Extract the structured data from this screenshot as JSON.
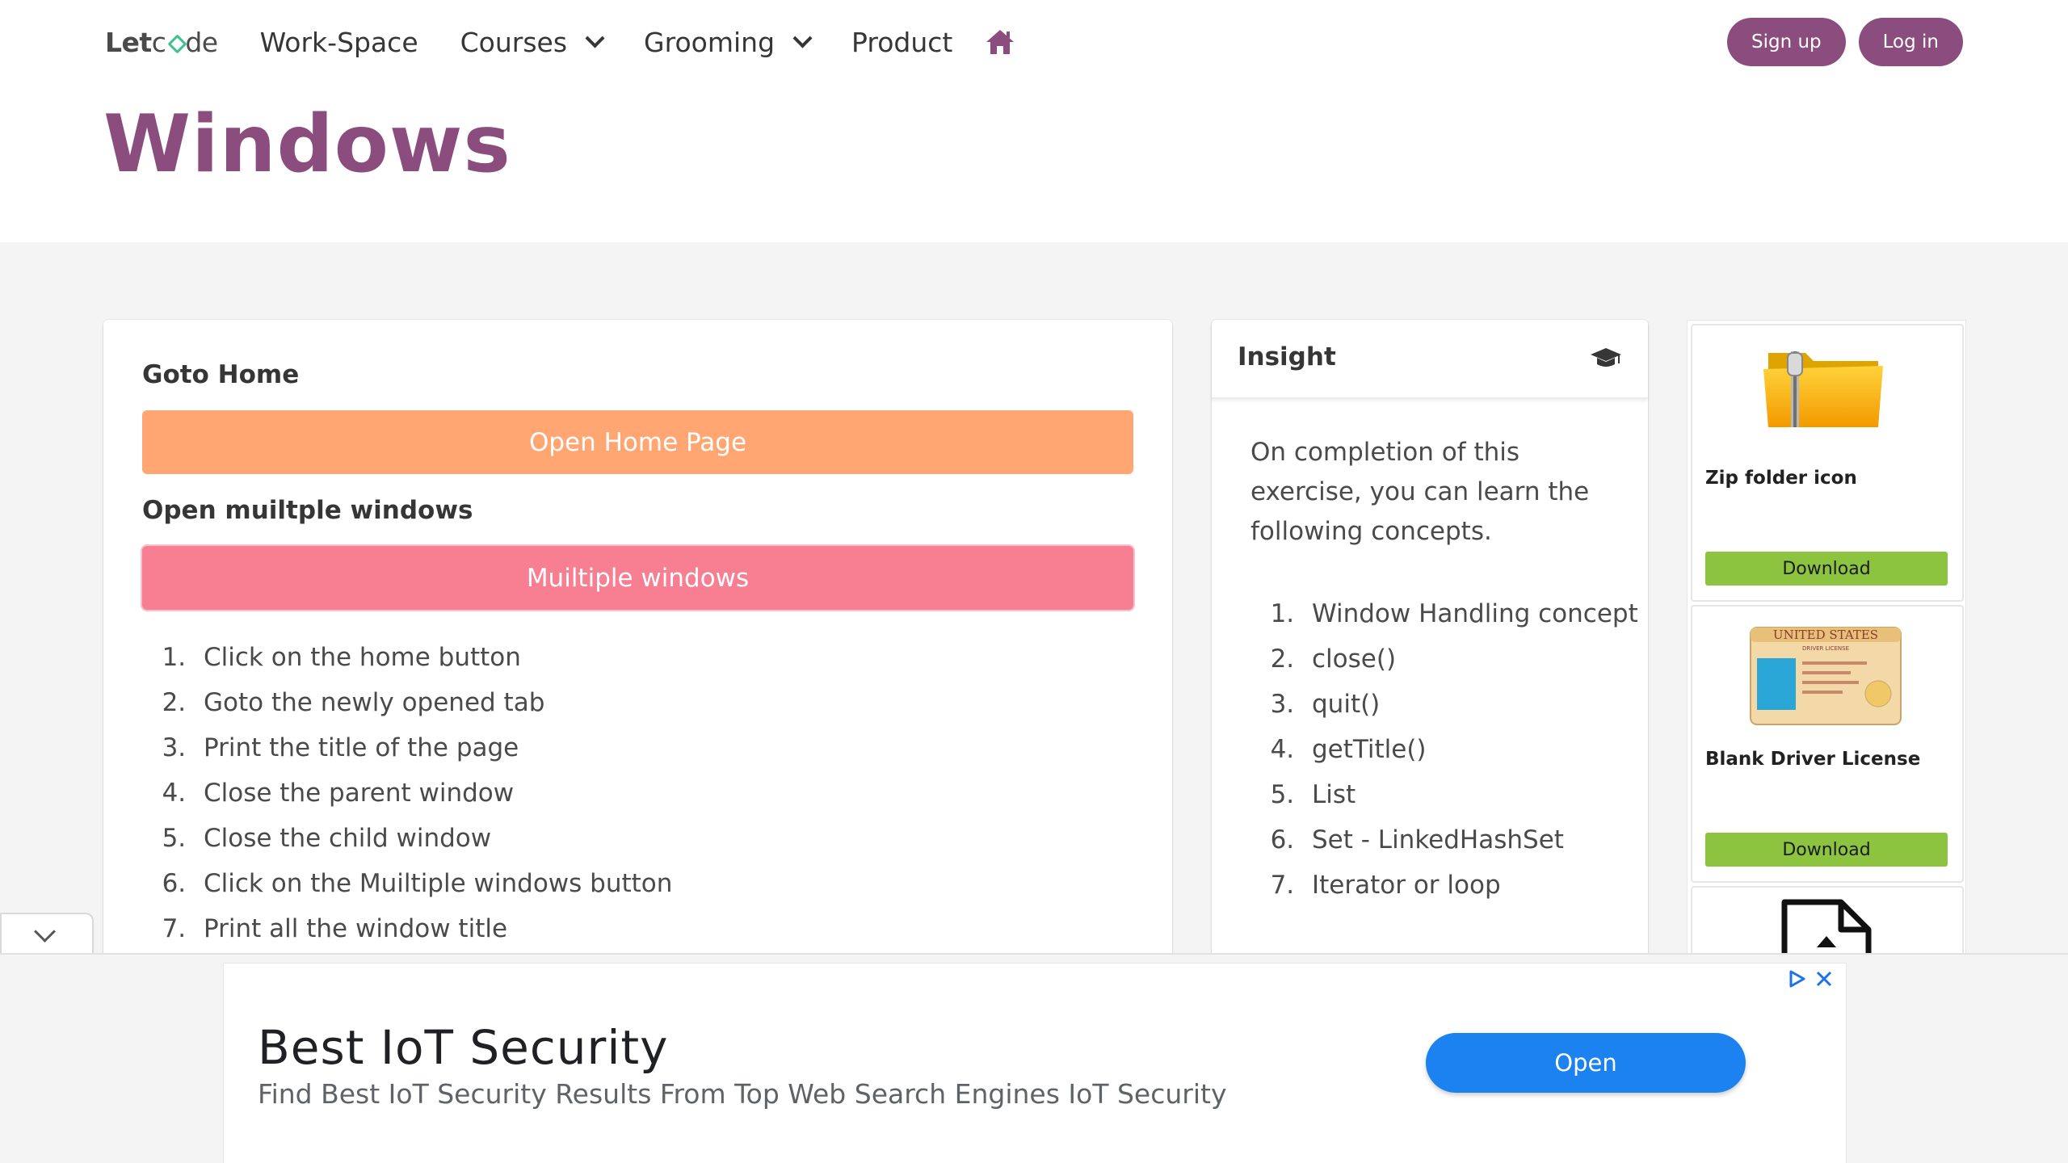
{
  "nav": {
    "logo_bold": "Let",
    "logo_light": "de",
    "items": [
      {
        "label": "Work-Space"
      },
      {
        "label": "Courses"
      },
      {
        "label": "Grooming"
      },
      {
        "label": "Product"
      }
    ],
    "signup": "Sign up",
    "login": "Log in"
  },
  "page": {
    "title": "Windows"
  },
  "main": {
    "goto_home_label": "Goto Home",
    "open_home_button": "Open Home Page",
    "multiple_label": "Open muiltple windows",
    "multiple_button": "Muiltiple windows",
    "steps": [
      "Click on the home button",
      "Goto the newly opened tab",
      "Print the title of the page",
      "Close the parent window",
      "Close the child window",
      "Click on the Muiltiple windows button",
      "Print all the window title"
    ]
  },
  "insight": {
    "title": "Insight",
    "intro": "On completion of this exercise, you can learn the following concepts.",
    "concepts": [
      "Window Handling concept",
      "close()",
      "quit()",
      "getTitle()",
      "List",
      "Set - LinkedHashSet",
      "Iterator or loop"
    ]
  },
  "side_ads": [
    {
      "caption": "Zip folder icon",
      "button": "Download",
      "icon": "zip-folder-icon"
    },
    {
      "caption": "Blank Driver License",
      "button": "Download",
      "icon": "driver-license-icon",
      "license_title": "UNITED STATES",
      "license_sub": "DRIVER LICENSE"
    },
    {
      "icon": "document-icon"
    }
  ],
  "banner": {
    "title": "Best IoT Security",
    "subtitle": "Find Best IoT Security Results From Top Web Search Engines IoT Security",
    "button": "Open"
  },
  "colors": {
    "brand": "#8b4c7e",
    "orange_button": "#ffa673",
    "pink_button": "#f87e91",
    "download_button": "#8cc43f",
    "open_button": "#1b82f0"
  }
}
